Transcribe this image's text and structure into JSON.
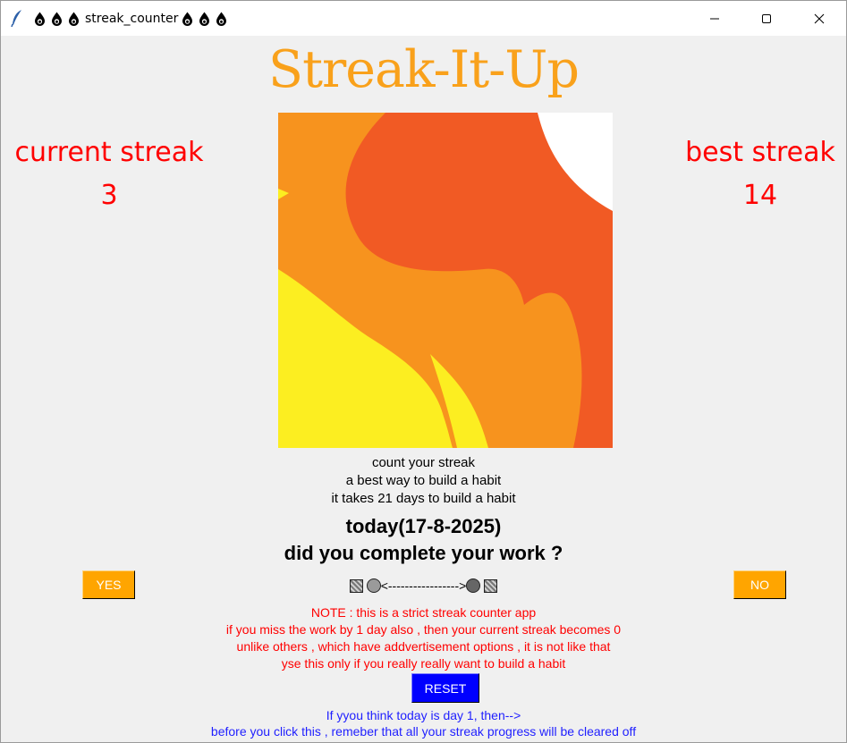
{
  "window": {
    "title": "streak_counter",
    "title_icon": "water-drop-icon",
    "controls": [
      "minimize-icon",
      "maximize-icon",
      "close-icon"
    ]
  },
  "app": {
    "title": "Streak-It-Up",
    "current_streak_label": "current streak",
    "current_streak_value": "3",
    "best_streak_label": "best streak",
    "best_streak_value": "14",
    "image": "flame-illustration"
  },
  "tagline": {
    "line1": "count your streak",
    "line2": "a best way to build a habit",
    "line3": "it takes 21 days to build a habit"
  },
  "question": {
    "date_line": "today(17-8-2025)",
    "prompt": "did you complete your work ?"
  },
  "buttons": {
    "yes": "YES",
    "no": "NO",
    "reset": "RESET"
  },
  "decoration": {
    "arrow": "<----------------->"
  },
  "note": {
    "line1": "NOTE : this is a strict streak counter app",
    "line2": "if you miss the work by 1 day also , then your current streak becomes 0",
    "line3": "unlike others , which have addvertisement options , it is not like that",
    "line4": "yse this only if you really really want to build a habit"
  },
  "info": {
    "line1": "If yyou think today is day 1, then-->",
    "line2": "before you click this , remeber that all your streak progress will be cleared off"
  },
  "colors": {
    "title": "#f9a11b",
    "streak": "#ff0000",
    "note": "#ff0000",
    "info": "#1f1fff",
    "yes_no_bg": "#ffa500",
    "reset_bg": "#0000ff",
    "background": "#f0f0f0"
  }
}
